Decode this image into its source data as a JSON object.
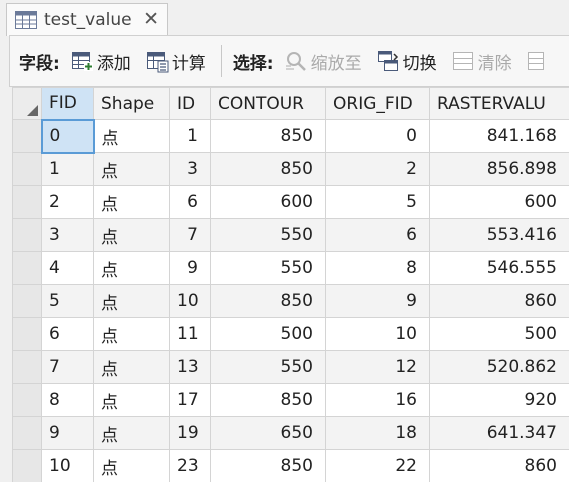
{
  "tab": {
    "title": "test_value",
    "close_glyph": "✕",
    "icon": "table-icon"
  },
  "toolbar": {
    "field_label": "字段:",
    "add_label": "添加",
    "calculate_label": "计算",
    "selection_label": "选择:",
    "zoom_to_label": "缩放至",
    "switch_label": "切换",
    "clear_label": "清除"
  },
  "columns": [
    "FID",
    "Shape",
    "ID",
    "CONTOUR",
    "ORIG_FID",
    "RASTERVALU"
  ],
  "rows": [
    [
      "0",
      "点",
      "1",
      "850",
      "0",
      "841.168"
    ],
    [
      "1",
      "点",
      "3",
      "850",
      "2",
      "856.898"
    ],
    [
      "2",
      "点",
      "6",
      "600",
      "5",
      "600"
    ],
    [
      "3",
      "点",
      "7",
      "550",
      "6",
      "553.416"
    ],
    [
      "4",
      "点",
      "9",
      "550",
      "8",
      "546.555"
    ],
    [
      "5",
      "点",
      "10",
      "850",
      "9",
      "860"
    ],
    [
      "6",
      "点",
      "11",
      "500",
      "10",
      "500"
    ],
    [
      "7",
      "点",
      "13",
      "550",
      "12",
      "520.862"
    ],
    [
      "8",
      "点",
      "17",
      "850",
      "16",
      "920"
    ],
    [
      "9",
      "点",
      "19",
      "650",
      "18",
      "641.347"
    ],
    [
      "10",
      "点",
      "23",
      "850",
      "22",
      "860"
    ]
  ],
  "colors": {
    "active_cell_bg": "#cfe3f5",
    "active_cell_border": "#5a9bd6",
    "header_bg": "#f3f3f3",
    "alt_row_bg": "#f3f3f3"
  }
}
